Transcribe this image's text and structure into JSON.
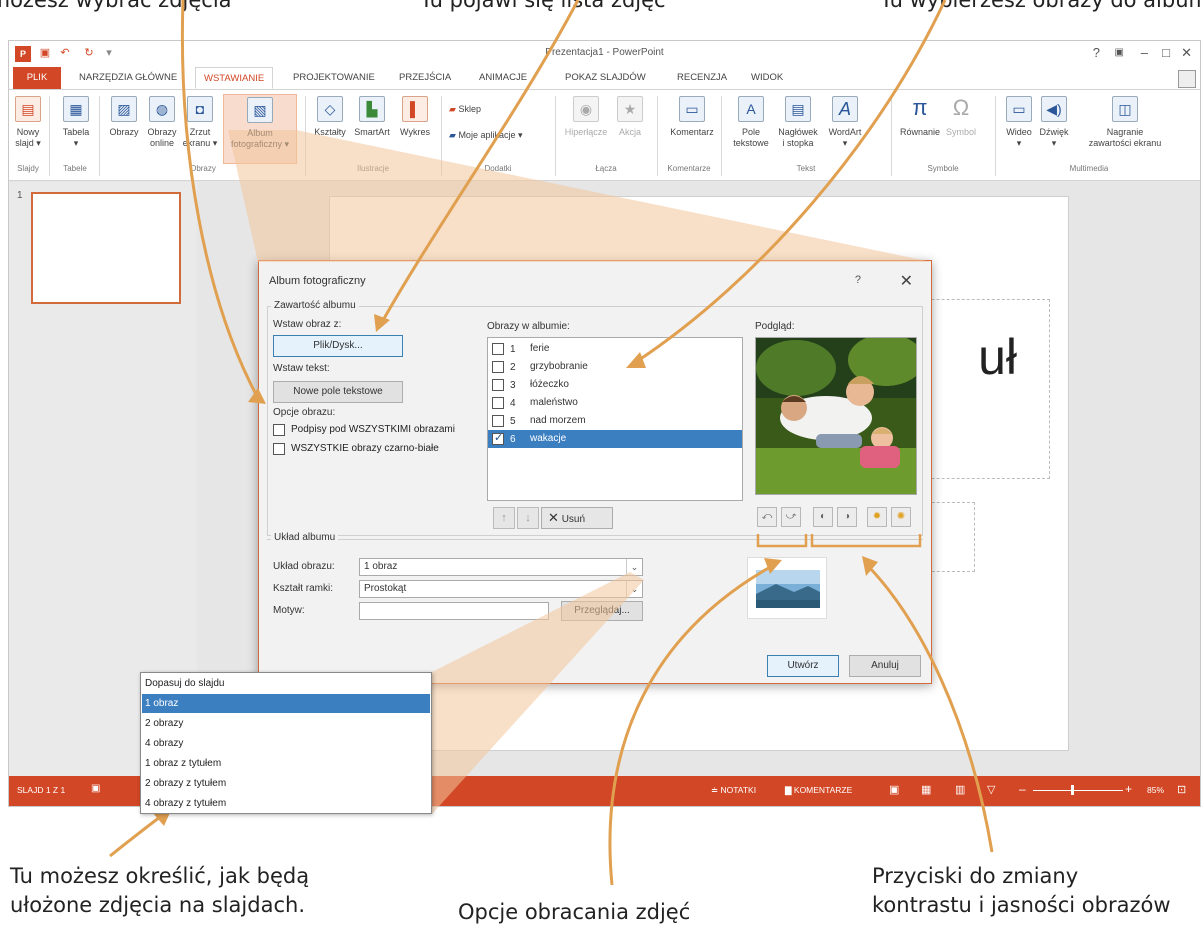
{
  "top_captions": [
    "Tu możesz wybrać zdjęcia",
    "Tu pojawi się lista zdjęć",
    "Tu wybierzesz obrazy do albumu"
  ],
  "window": {
    "title": "Prezentacja1 - PowerPoint",
    "controls": [
      "?",
      "▣",
      "–",
      "□",
      "✕"
    ]
  },
  "ribbon_tabs": [
    "PLIK",
    "NARZĘDZIA GŁÓWNE",
    "WSTAWIANIE",
    "PROJEKTOWANIE",
    "PRZEJŚCIA",
    "ANIMACJE",
    "POKAZ SLAJDÓW",
    "RECENZJA",
    "WIDOK"
  ],
  "ribbon": {
    "buttons": [
      {
        "label": "Nowy\nslajd ▾",
        "icon": "new-slide-icon"
      },
      {
        "label": "Tabela\n▾",
        "icon": "table-icon"
      },
      {
        "label": "Obrazy",
        "icon": "pictures-icon"
      },
      {
        "label": "Obrazy\nonline",
        "icon": "online-pictures-icon"
      },
      {
        "label": "Zrzut\nekranu ▾",
        "icon": "screenshot-icon"
      },
      {
        "label": "Album\nfotograficzny ▾",
        "icon": "photo-album-icon"
      },
      {
        "label": "Kształty",
        "icon": "shapes-icon"
      },
      {
        "label": "SmartArt",
        "icon": "smartart-icon"
      },
      {
        "label": "Wykres",
        "icon": "chart-icon"
      },
      {
        "label": "Sklep",
        "icon": "store-icon"
      },
      {
        "label": "Moje aplikacje ▾",
        "icon": "my-apps-icon"
      },
      {
        "label": "Hiperłącze",
        "icon": "hyperlink-icon"
      },
      {
        "label": "Akcja",
        "icon": "action-icon"
      },
      {
        "label": "Komentarz",
        "icon": "comment-icon"
      },
      {
        "label": "Pole\ntekstowe",
        "icon": "textbox-icon"
      },
      {
        "label": "Nagłówek\ni stopka",
        "icon": "header-footer-icon"
      },
      {
        "label": "WordArt\n▾",
        "icon": "wordart-icon"
      },
      {
        "label": "Równanie",
        "icon": "equation-icon"
      },
      {
        "label": "Symbol",
        "icon": "symbol-icon"
      },
      {
        "label": "Wideo\n▾",
        "icon": "video-icon"
      },
      {
        "label": "Dźwięk\n▾",
        "icon": "audio-icon"
      },
      {
        "label": "Nagranie\nzawartości ekranu",
        "icon": "screen-recording-icon"
      }
    ],
    "groups": [
      "Slajdy",
      "Tabele",
      "Obrazy",
      "Ilustracje",
      "Dodatki",
      "Łącza",
      "Komentarze",
      "Tekst",
      "Symbole",
      "Multimedia"
    ]
  },
  "thumbnail": {
    "number": "1"
  },
  "slide": {
    "title_fragment": "uł"
  },
  "status": {
    "slide_info": "SLAJD 1 Z 1",
    "notes": "≐ NOTATKI",
    "comments": "▇ KOMENTARZE",
    "zoom": "85%"
  },
  "dialog": {
    "title": "Album fotograficzny",
    "help": "?",
    "close": "✕",
    "content_group": "Zawartość albumu",
    "insert_from_label": "Wstaw obraz z:",
    "file_disk_button": "Plik/Dysk...",
    "insert_text_label": "Wstaw tekst:",
    "new_textbox_button": "Nowe pole tekstowe",
    "picture_options_label": "Opcje obrazu:",
    "captions_option": "Podpisy pod WSZYSTKIMI obrazami",
    "bw_option": "WSZYSTKIE obrazy czarno-białe",
    "pictures_in_album_label": "Obrazy w albumie:",
    "pictures": [
      {
        "num": "1",
        "name": "ferie",
        "checked": false
      },
      {
        "num": "2",
        "name": "grzybobranie",
        "checked": false
      },
      {
        "num": "3",
        "name": "łóżeczko",
        "checked": false
      },
      {
        "num": "4",
        "name": "maleństwo",
        "checked": false
      },
      {
        "num": "5",
        "name": "nad morzem",
        "checked": false
      },
      {
        "num": "6",
        "name": "wakacje",
        "checked": true
      }
    ],
    "remove_button": "Usuń",
    "preview_label": "Podgląd:",
    "layout_group": "Układ albumu",
    "picture_layout_label": "Układ obrazu:",
    "picture_layout_value": "1 obraz",
    "frame_shape_label": "Kształt ramki:",
    "frame_shape_value": "Prostokąt",
    "theme_label": "Motyw:",
    "theme_value": "",
    "browse_button": "Przeglądaj...",
    "create_button": "Utwórz",
    "cancel_button": "Anuluj"
  },
  "layout_dropdown": {
    "options": [
      "Dopasuj do slajdu",
      "1 obraz",
      "2 obrazy",
      "4 obrazy",
      "1 obraz z tytułem",
      "2 obrazy z tytułem",
      "4 obrazy z tytułem"
    ],
    "selected": "1 obraz"
  },
  "captions": {
    "layout_caption_line1": "Tu możesz określić, jak będą",
    "layout_caption_line2": "ułożone zdjęcia na slajdach.",
    "rotate_caption": "Opcje obracania zdjęć",
    "contrast_caption_line1": "Przyciski do zmiany",
    "contrast_caption_line2": "kontrastu i jasności obrazów"
  },
  "colors": {
    "accent": "#d24726",
    "callout": "#e0a050",
    "selection": "#3c7fc1"
  }
}
